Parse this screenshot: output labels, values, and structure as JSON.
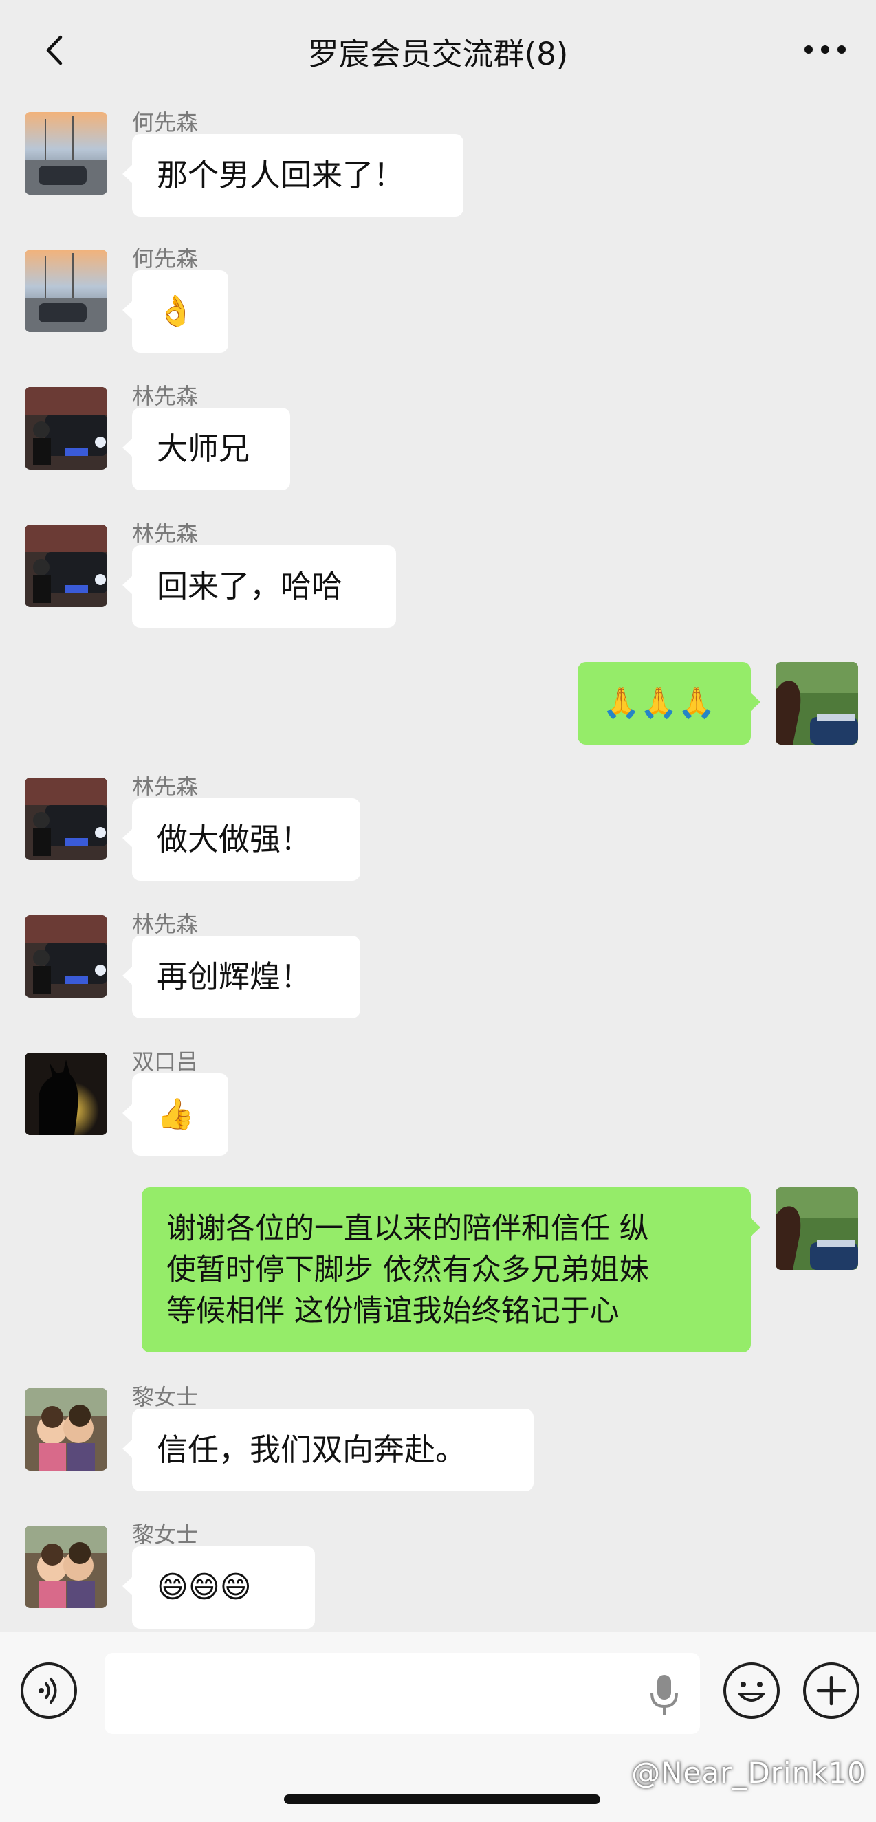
{
  "nav": {
    "title": "罗宸会员交流群(8)"
  },
  "messages": [
    {
      "sender": "何先森",
      "text": "那个男人回来了！"
    },
    {
      "sender": "何先森",
      "text": "👌"
    },
    {
      "sender": "林先森",
      "text": "大师兄"
    },
    {
      "sender": "林先森",
      "text": "回来了，哈哈"
    },
    {
      "sender": "",
      "text": "🙏🙏🙏"
    },
    {
      "sender": "林先森",
      "text": "做大做强！"
    },
    {
      "sender": "林先森",
      "text": "再创辉煌！"
    },
    {
      "sender": "双口吕",
      "text": "👍"
    },
    {
      "sender": "",
      "text": "谢谢各位的一直以来的陪伴和信任 纵\n使暂时停下脚步 依然有众多兄弟姐妹\n等候相伴 这份情谊我始终铭记于心"
    },
    {
      "sender": "黎女士",
      "text": "信任，我们双向奔赴。"
    },
    {
      "sender": "黎女士",
      "text": "😄😄😄"
    }
  ],
  "input": {
    "value": "",
    "placeholder": ""
  },
  "watermark": "@Near_Drink10",
  "colors": {
    "background": "#ededed",
    "bubble_self": "#95ec69",
    "bubble_other": "#ffffff"
  },
  "icons": {
    "back": "back-chevron-icon",
    "more": "more-dots-icon",
    "voice": "voice-mode-icon",
    "mic": "microphone-icon",
    "emoji": "emoji-icon",
    "plus": "plus-icon"
  }
}
